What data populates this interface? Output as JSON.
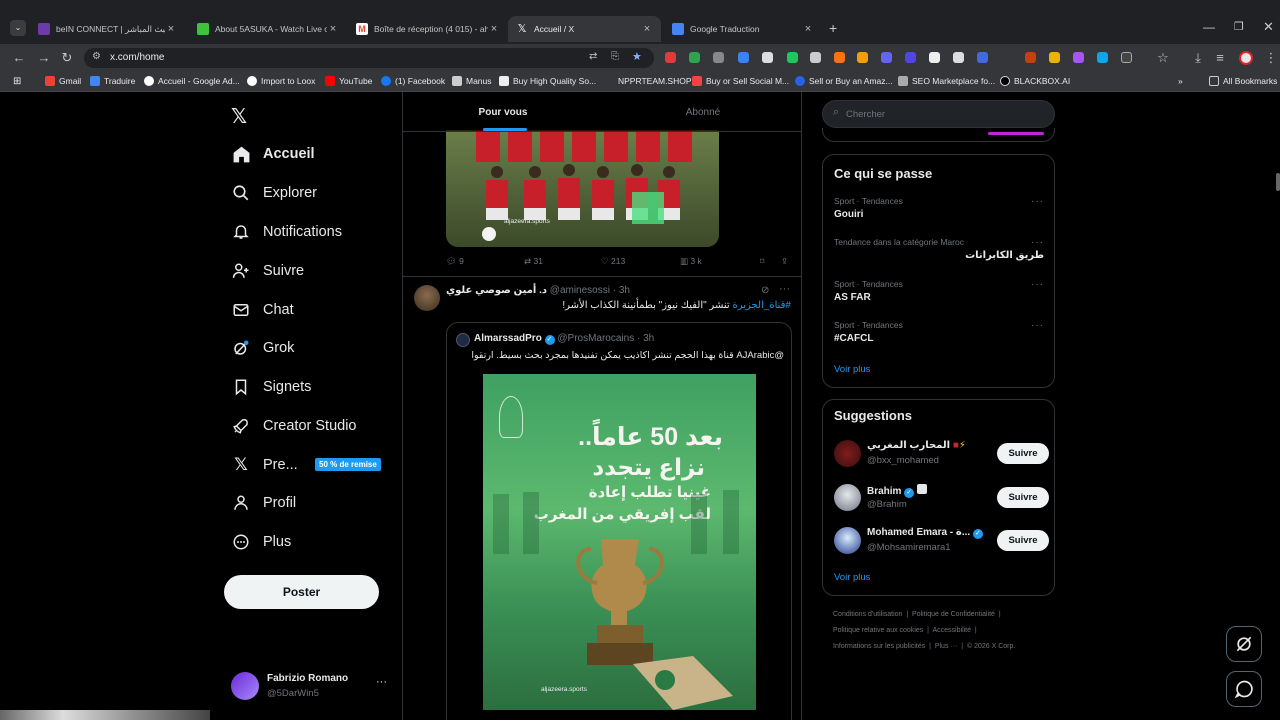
{
  "browser": {
    "tabs": [
      {
        "title": "beIN CONNECT | البث المباشر | L",
        "color": "#6c3baa"
      },
      {
        "title": "About 5ASUKA - Watch Live on",
        "color": "#3cc23c"
      },
      {
        "title": "Boîte de réception (4 015) - ahe",
        "color": "#ea4335"
      },
      {
        "title": "Accueil / X",
        "color": "#000000"
      },
      {
        "title": "Google Traduction",
        "color": "#4285f4"
      }
    ],
    "url": "x.com/home",
    "bookmarks": [
      "Gmail",
      "Traduire",
      "Accueil - Google Ad...",
      "Import to Loox",
      "YouTube",
      "(1) Facebook",
      "Manus",
      "Buy High Quality So...",
      "NPPRTEAM.SHOP",
      "Buy or Sell Social M...",
      "Sell or Buy an Amaz...",
      "SEO Marketplace fo...",
      "BLACKBOX.AI",
      "All Bookmarks"
    ]
  },
  "nav": {
    "items": [
      {
        "label": "Accueil",
        "icon": "home-icon"
      },
      {
        "label": "Explorer",
        "icon": "search-icon"
      },
      {
        "label": "Notifications",
        "icon": "bell-icon"
      },
      {
        "label": "Suivre",
        "icon": "person-add-icon"
      },
      {
        "label": "Chat",
        "icon": "mail-icon"
      },
      {
        "label": "Grok",
        "icon": "grok-icon"
      },
      {
        "label": "Signets",
        "icon": "bookmark-icon"
      },
      {
        "label": "Creator Studio",
        "icon": "rocket-icon"
      },
      {
        "label": "Pre...",
        "icon": "x-icon"
      },
      {
        "label": "Profil",
        "icon": "profile-icon"
      },
      {
        "label": "Plus",
        "icon": "more-icon"
      }
    ],
    "premium_badge": "50 % de remise",
    "post_button": "Poster",
    "account": {
      "name": "Fabrizio Romano",
      "handle": "@5DarWin5"
    }
  },
  "feed": {
    "tabs": [
      "Pour vous",
      "Abonné"
    ],
    "post1": {
      "image_caption": "aljazeera.sports",
      "replies": "9",
      "reposts": "31",
      "likes": "213",
      "views": "3 k"
    },
    "post2": {
      "author": "د. أمين صوصي علوي",
      "handle": "@aminesossi",
      "time": "3h",
      "hashtag": "#قناة_الجزيرة",
      "text": "تنشر \"الفيك نيوز\" بطمأنينة الكذاب الأشر!",
      "quote": {
        "author": "AlmarssadPro",
        "handle": "@ProsMarocains",
        "time": "3h",
        "mention": "@AJArabic",
        "text": "قناة بهذا الحجم تنشر اكاذيب يمكن تفنيدها بمجرد بحث بسيط. ارتقوا",
        "image_lines": [
          "بعد 50 عاماً..",
          "نزاع يتجدد",
          "غينيا تطلب إعادة",
          "لقب إفريقي من المغرب"
        ],
        "image_caption": "aljazeera.sports"
      }
    }
  },
  "right": {
    "search_placeholder": "Chercher",
    "trends_title": "Ce qui se passe",
    "trends": [
      {
        "category": "Sport · Tendances",
        "name": "Gouiri"
      },
      {
        "category": "Tendance dans la catégorie Maroc",
        "name": "طريق الكابرانات"
      },
      {
        "category": "Sport · Tendances",
        "name": "AS FAR"
      },
      {
        "category": "Sport · Tendances",
        "name": "#CAFCL"
      }
    ],
    "see_more": "Voir plus",
    "suggestions_title": "Suggestions",
    "suggestions": [
      {
        "name": "المحارب المغربي",
        "handle": "@bxx_mohamed",
        "follow": "Suivre"
      },
      {
        "name": "Brahim",
        "handle": "@Brahim",
        "follow": "Suivre"
      },
      {
        "name": "Mohamed Emara - ة...",
        "handle": "@Mohsamiremara1",
        "follow": "Suivre"
      }
    ],
    "footer": [
      "Conditions d'utilisation",
      "Politique de Confidentialité",
      "Politique relative aux cookies",
      "Accessibilité",
      "Informations sur les publicités",
      "Plus ···",
      "© 2026 X Corp."
    ]
  }
}
